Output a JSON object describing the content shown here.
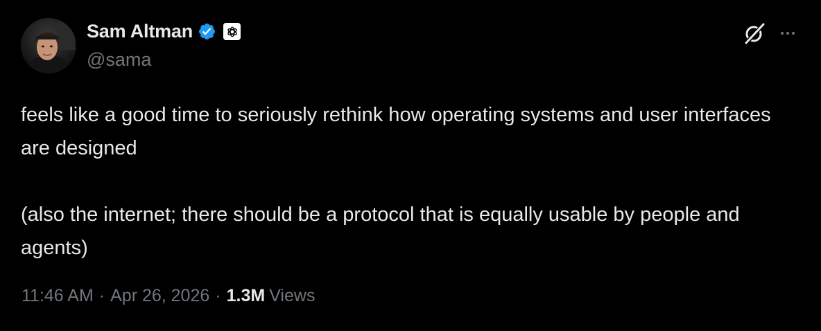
{
  "author": {
    "display_name": "Sam Altman",
    "handle": "@sama",
    "verified_badge_color": "#1d9bf0",
    "affiliate_icon": "openai-logo-icon"
  },
  "tweet": {
    "paragraphs": [
      "feels like a good time to seriously rethink how operating systems and user interfaces are designed",
      "(also the internet; there should be a protocol that is equally usable by people and agents)"
    ]
  },
  "meta": {
    "time": "11:46 AM",
    "separator": "·",
    "date": "Apr 26, 2026",
    "views_count": "1.3M",
    "views_label": "Views"
  },
  "icons": {
    "grok": "grok-icon",
    "more": "more-options-icon"
  }
}
